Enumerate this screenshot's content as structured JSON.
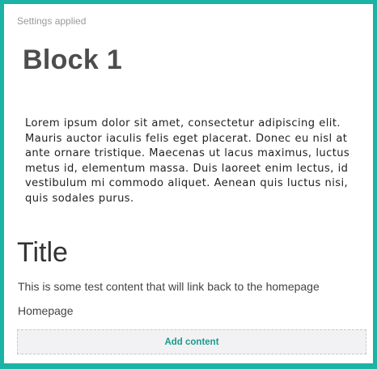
{
  "status_text": "Settings applied",
  "block": {
    "title": "Block 1",
    "body": "Lorem ipsum dolor sit amet, consectetur adipiscing elit. Mauris auctor iaculis felis eget placerat. Donec eu nisl at ante ornare tristique. Maecenas ut lacus maximus, luctus metus id, elementum massa. Duis laoreet enim lectus, id vestibulum mi commodo aliquet. Aenean quis luctus nisi, quis sodales purus."
  },
  "section": {
    "title": "Title",
    "description": "This is some test content that will link back to the homepage",
    "link_label": "Homepage"
  },
  "actions": {
    "add_content_label": "Add content"
  },
  "colors": {
    "accent": "#1ab3a6",
    "button_text": "#1a9a8c"
  }
}
